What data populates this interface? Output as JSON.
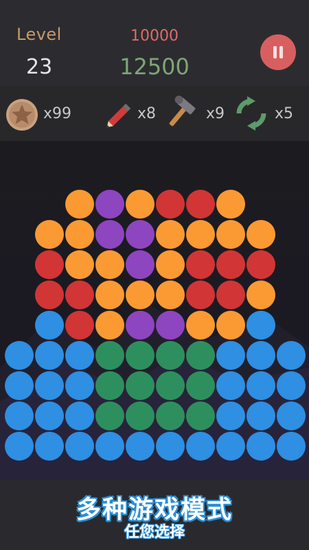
{
  "header": {
    "level_label": "Level",
    "level_value": "23",
    "target_score": "10000",
    "current_score": "12500"
  },
  "powerups": [
    {
      "name": "star",
      "icon": "star-icon",
      "count": "x99"
    },
    {
      "name": "pencil",
      "icon": "pencil-icon",
      "count": "x8"
    },
    {
      "name": "hammer",
      "icon": "hammer-icon",
      "count": "x9"
    },
    {
      "name": "shuffle",
      "icon": "refresh-icon",
      "count": "x5"
    }
  ],
  "colors": {
    "O": "#fb9a33",
    "P": "#8e45c0",
    "R": "#d13535",
    "B": "#2e8fe3",
    "G": "#2e8f5e"
  },
  "board_rows": [
    "..OPORRO..",
    ".OOPPOOOO.",
    ".ROOPORRR.",
    ".RROOORRO.",
    ".BROPPOOB.",
    "BBBGGGGBBB",
    "BBBGGGGBBB",
    "BBBGGGGBBB",
    "BBBBBBBBBB"
  ],
  "footer": {
    "title": "多种游戏模式",
    "subtitle": "任您选择"
  }
}
